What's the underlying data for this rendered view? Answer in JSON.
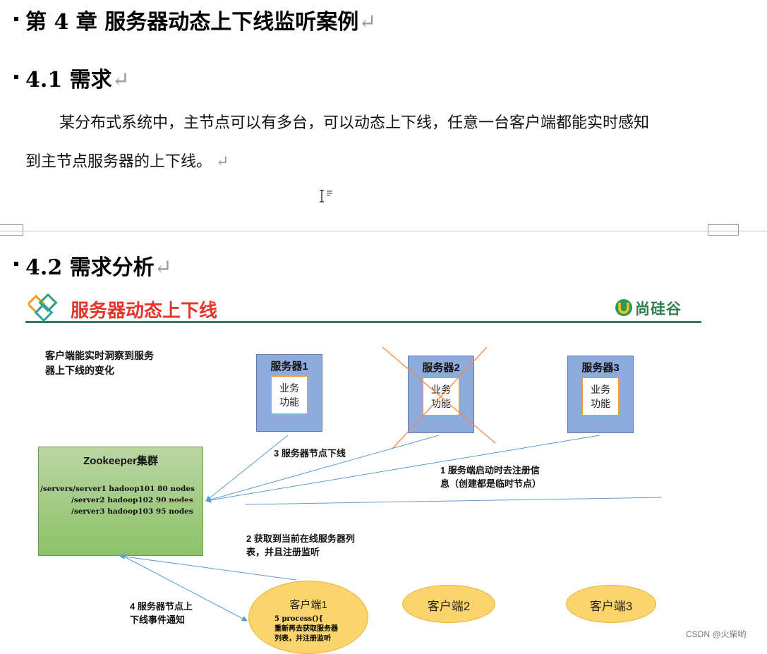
{
  "chapter": {
    "title": "第 4 章  服务器动态上下线监听案例",
    "mark": "↵"
  },
  "section1": {
    "title": "4.1  需求",
    "mark": "↵",
    "para_line1": "某分布式系统中，主节点可以有多台，可以动态上下线，任意一台客户端都能实时感知",
    "para_line2": "到主节点服务器的上下线。",
    "para_mark": "↵"
  },
  "section2": {
    "title": "4.2  需求分析",
    "mark": "↵"
  },
  "diagram": {
    "title": "服务器动态上下线",
    "logo_text": "尚硅谷",
    "intro": [
      "客户端能实时洞察到服务",
      "器上下线的变化"
    ],
    "servers": [
      {
        "label": "服务器1",
        "biz": [
          "业务",
          "功能"
        ]
      },
      {
        "label": "服务器2",
        "biz": [
          "业务",
          "功能"
        ]
      },
      {
        "label": "服务器3",
        "biz": [
          "业务",
          "功能"
        ]
      }
    ],
    "zookeeper": {
      "title": "Zookeeper集群",
      "lines": [
        "/servers/server1  hadoop101  80 nodes",
        "/server2 hadoop102  90 nodes",
        "/server3 hadoop103  95 nodes"
      ]
    },
    "notes": {
      "n1": [
        "1  服务端启动时去注册信",
        "息（创建都是临时节点）"
      ],
      "n2": [
        "2  获取到当前在线服务器列",
        "表，并且注册监听"
      ],
      "n3": "3 服务器节点下线",
      "n4": [
        "4  服务器节点上",
        "下线事件通知"
      ]
    },
    "clients": [
      {
        "label": "客户端1",
        "sub": [
          "5 process(){",
          "重新再去获取服务器",
          "列表，并注册监听"
        ]
      },
      {
        "label": "客户端2"
      },
      {
        "label": "客户端3"
      }
    ]
  },
  "watermark": "CSDN @火柴哟",
  "colors": {
    "accent_red": "#e8332c",
    "divider_green": "#2e7d60",
    "server_blue": "#8faadc",
    "zk_green": "#8ec16a",
    "client_yellow": "#fbd46b"
  }
}
